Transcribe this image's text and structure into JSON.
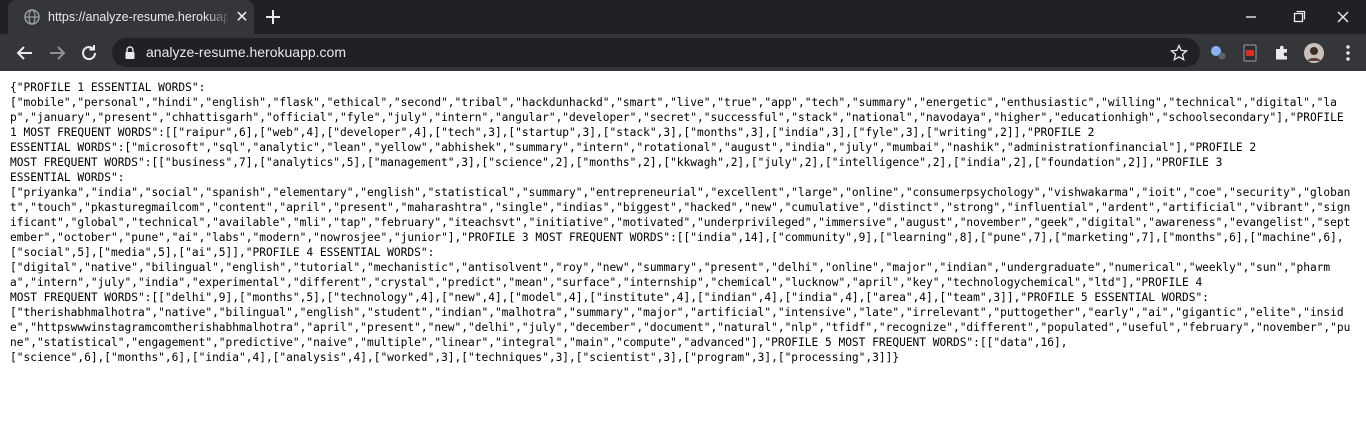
{
  "browser": {
    "tab_title": "https://analyze-resume.herokuap",
    "tab_close_glyph": "✕",
    "url": "analyze-resume.herokuapp.com",
    "colors": {
      "frame": "#202124",
      "toolbar": "#35363a",
      "text": "#e8eaed"
    }
  },
  "page": {
    "raw_text": "{\"PROFILE 1 ESSENTIAL WORDS\":\n[\"mobile\",\"personal\",\"hindi\",\"english\",\"flask\",\"ethical\",\"second\",\"tribal\",\"hackdunhackd\",\"smart\",\"live\",\"true\",\"app\",\"tech\",\"summary\",\"energetic\",\"enthusiastic\",\"willing\",\"technical\",\"digital\",\"lap\",\"january\",\"present\",\"chhattisgarh\",\"official\",\"fyle\",\"july\",\"intern\",\"angular\",\"developer\",\"secret\",\"successful\",\"stack\",\"national\",\"navodaya\",\"higher\",\"educationhigh\",\"schoolsecondary\"],\"PROFILE 1 MOST FREQUENT WORDS\":[[\"raipur\",6],[\"web\",4],[\"developer\",4],[\"tech\",3],[\"startup\",3],[\"stack\",3],[\"months\",3],[\"india\",3],[\"fyle\",3],[\"writing\",2]],\"PROFILE 2\nESSENTIAL WORDS\":[\"microsoft\",\"sql\",\"analytic\",\"lean\",\"yellow\",\"abhishek\",\"summary\",\"intern\",\"rotational\",\"august\",\"india\",\"july\",\"mumbai\",\"nashik\",\"administrationfinancial\"],\"PROFILE 2\nMOST FREQUENT WORDS\":[[\"business\",7],[\"analytics\",5],[\"management\",3],[\"science\",2],[\"months\",2],[\"kkwagh\",2],[\"july\",2],[\"intelligence\",2],[\"india\",2],[\"foundation\",2]],\"PROFILE 3\nESSENTIAL WORDS\":\n[\"priyanka\",\"india\",\"social\",\"spanish\",\"elementary\",\"english\",\"statistical\",\"summary\",\"entrepreneurial\",\"excellent\",\"large\",\"online\",\"consumerpsychology\",\"vishwakarma\",\"ioit\",\"coe\",\"security\",\"globant\",\"touch\",\"pkasturegmailcom\",\"content\",\"april\",\"present\",\"maharashtra\",\"single\",\"indias\",\"biggest\",\"hacked\",\"new\",\"cumulative\",\"distinct\",\"strong\",\"influential\",\"ardent\",\"artificial\",\"vibrant\",\"significant\",\"global\",\"technical\",\"available\",\"mli\",\"tap\",\"february\",\"iteachsvt\",\"initiative\",\"motivated\",\"underprivileged\",\"immersive\",\"august\",\"november\",\"geek\",\"digital\",\"awareness\",\"evangelist\",\"september\",\"october\",\"pune\",\"ai\",\"labs\",\"modern\",\"nowrosjee\",\"junior\"],\"PROFILE 3 MOST FREQUENT WORDS\":[[\"india\",14],[\"community\",9],[\"learning\",8],[\"pune\",7],[\"marketing\",7],[\"months\",6],[\"machine\",6],[\"social\",5],[\"media\",5],[\"ai\",5]],\"PROFILE 4 ESSENTIAL WORDS\":\n[\"digital\",\"native\",\"bilingual\",\"english\",\"tutorial\",\"mechanistic\",\"antisolvent\",\"roy\",\"new\",\"summary\",\"present\",\"delhi\",\"online\",\"major\",\"indian\",\"undergraduate\",\"numerical\",\"weekly\",\"sun\",\"pharma\",\"intern\",\"july\",\"india\",\"experimental\",\"different\",\"crystal\",\"predict\",\"mean\",\"surface\",\"internship\",\"chemical\",\"lucknow\",\"april\",\"key\",\"technologychemical\",\"ltd\"],\"PROFILE 4\nMOST FREQUENT WORDS\":[[\"delhi\",9],[\"months\",5],[\"technology\",4],[\"new\",4],[\"model\",4],[\"institute\",4],[\"indian\",4],[\"india\",4],[\"area\",4],[\"team\",3]],\"PROFILE 5 ESSENTIAL WORDS\":\n[\"therishabhmalhotra\",\"native\",\"bilingual\",\"english\",\"student\",\"indian\",\"malhotra\",\"summary\",\"major\",\"artificial\",\"intensive\",\"late\",\"irrelevant\",\"puttogether\",\"early\",\"ai\",\"gigantic\",\"elite\",\"inside\",\"httpswwwinstagramcomtherishabhmalhotra\",\"april\",\"present\",\"new\",\"delhi\",\"july\",\"december\",\"document\",\"natural\",\"nlp\",\"tfidf\",\"recognize\",\"different\",\"populated\",\"useful\",\"february\",\"november\",\"pune\",\"statistical\",\"engagement\",\"predictive\",\"naive\",\"multiple\",\"linear\",\"integral\",\"main\",\"compute\",\"advanced\"],\"PROFILE 5 MOST FREQUENT WORDS\":[[\"data\",16],\n[\"science\",6],[\"months\",6],[\"india\",4],[\"analysis\",4],[\"worked\",3],[\"techniques\",3],[\"scientist\",3],[\"program\",3],[\"processing\",3]]}"
  }
}
